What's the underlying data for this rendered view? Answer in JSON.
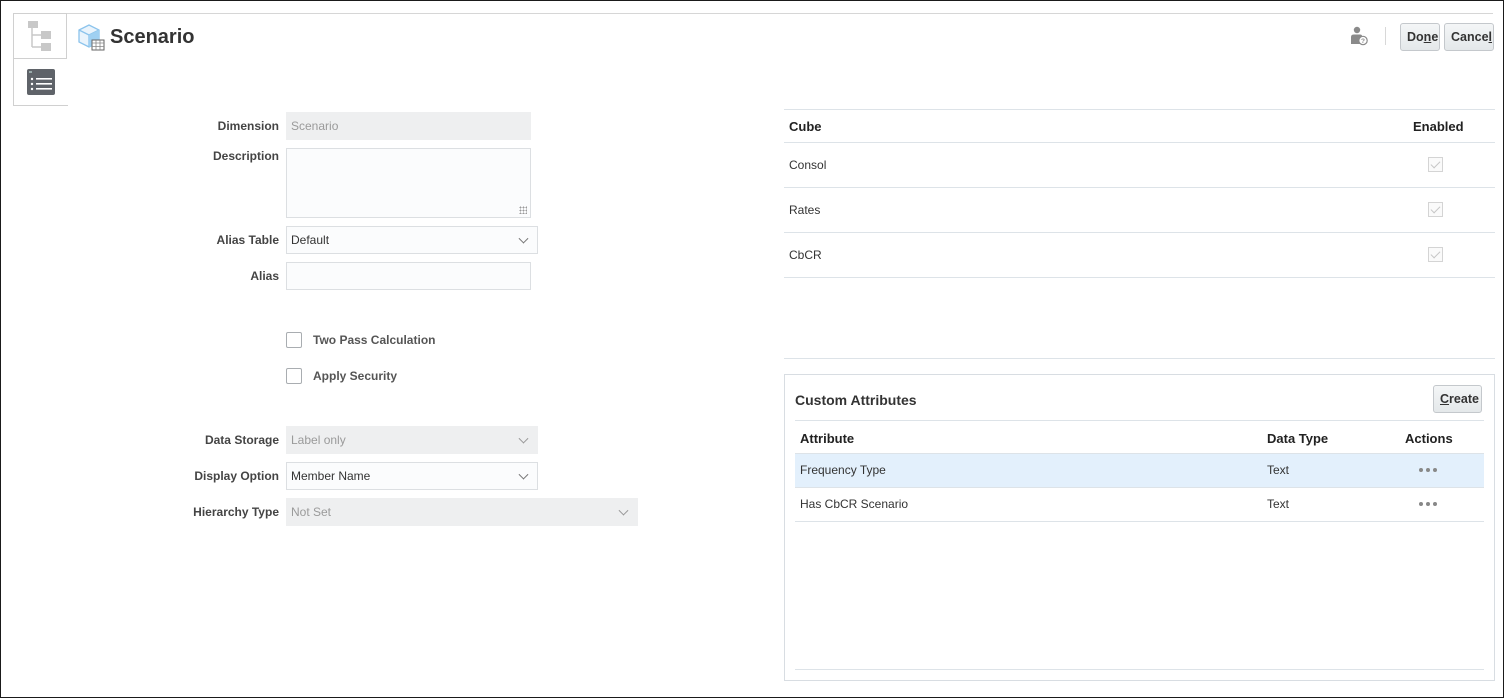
{
  "header": {
    "title": "Scenario",
    "help_icon": "user-help-icon",
    "done_label": "Done",
    "done_mnemonic_index": 2,
    "cancel_label": "Cancel",
    "cancel_mnemonic_index": 5
  },
  "side_tabs": [
    {
      "icon": "hierarchy-tree-icon",
      "selected": false
    },
    {
      "icon": "list-properties-icon",
      "selected": true
    }
  ],
  "form": {
    "dimension": {
      "label": "Dimension",
      "value": "Scenario"
    },
    "description": {
      "label": "Description",
      "value": ""
    },
    "alias_table": {
      "label": "Alias Table",
      "value": "Default"
    },
    "alias": {
      "label": "Alias",
      "value": ""
    },
    "two_pass": {
      "label": "Two Pass Calculation",
      "checked": false
    },
    "apply_security": {
      "label": "Apply Security",
      "checked": false
    },
    "data_storage": {
      "label": "Data Storage",
      "value": "Label only"
    },
    "display_option": {
      "label": "Display Option",
      "value": "Member Name"
    },
    "hierarchy_type": {
      "label": "Hierarchy Type",
      "value": "Not Set"
    }
  },
  "cube_table": {
    "headers": {
      "cube": "Cube",
      "enabled": "Enabled"
    },
    "rows": [
      {
        "cube": "Consol",
        "enabled": true
      },
      {
        "cube": "Rates",
        "enabled": true
      },
      {
        "cube": "CbCR",
        "enabled": true
      }
    ]
  },
  "custom_attributes": {
    "title": "Custom Attributes",
    "create_label": "Create",
    "headers": {
      "attribute": "Attribute",
      "data_type": "Data Type",
      "actions": "Actions"
    },
    "rows": [
      {
        "attribute": "Frequency Type",
        "data_type": "Text",
        "selected": true
      },
      {
        "attribute": "Has CbCR Scenario",
        "data_type": "Text",
        "selected": false
      }
    ]
  }
}
